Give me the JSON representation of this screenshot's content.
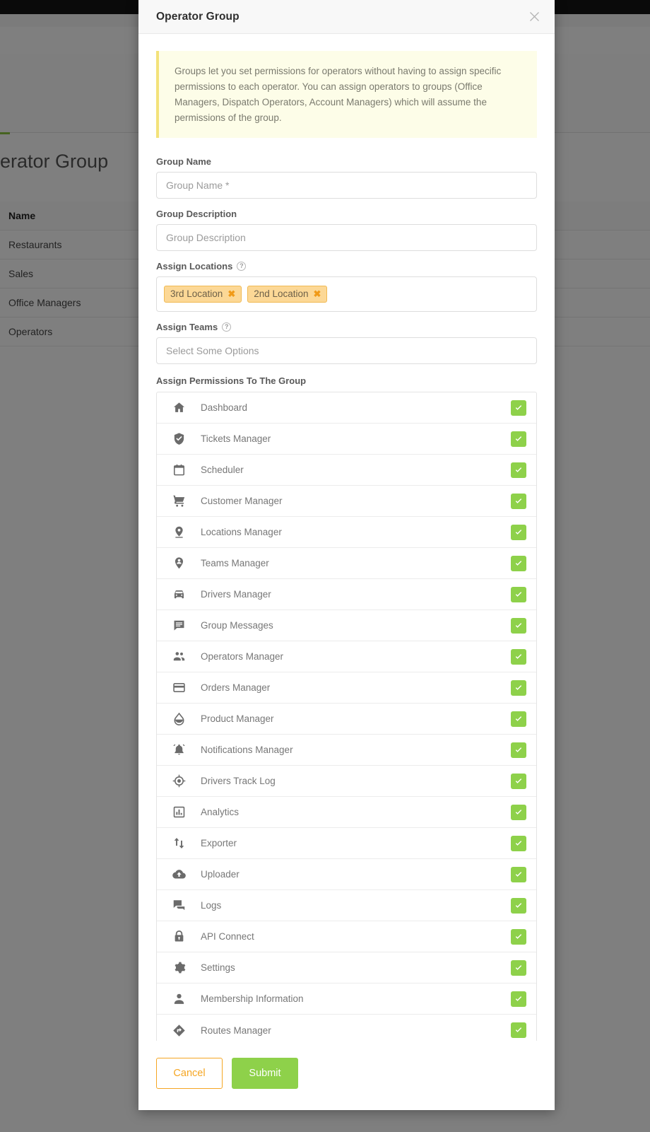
{
  "background": {
    "page_title": "Operator Group",
    "table": {
      "column_header": "Name",
      "rows": [
        "Restaurants",
        "Sales",
        "Office Managers",
        "Operators"
      ]
    }
  },
  "modal": {
    "title": "Operator Group",
    "close_icon": "close-icon",
    "info_text": "Groups let you set permissions for operators without having to assign specific permissions to each operator. You can assign operators to groups (Office Managers, Dispatch Operators, Account Managers) which will assume the permissions of the group.",
    "fields": {
      "group_name": {
        "label": "Group Name",
        "placeholder": "Group Name *",
        "value": ""
      },
      "group_description": {
        "label": "Group Description",
        "placeholder": "Group Description",
        "value": ""
      },
      "assign_locations": {
        "label": "Assign Locations",
        "help_icon": "help-circle-icon",
        "tags": [
          "3rd Location",
          "2nd Location"
        ],
        "tag_remove_glyph": "✖"
      },
      "assign_teams": {
        "label": "Assign Teams",
        "help_icon": "help-circle-icon",
        "placeholder": "Select Some Options",
        "value": ""
      }
    },
    "permissions": {
      "label": "Assign Permissions To The Group",
      "items": [
        {
          "label": "Dashboard",
          "icon": "home-icon",
          "checked": true
        },
        {
          "label": "Tickets Manager",
          "icon": "shield-check-icon",
          "checked": true
        },
        {
          "label": "Scheduler",
          "icon": "calendar-icon",
          "checked": true
        },
        {
          "label": "Customer Manager",
          "icon": "shopping-cart-icon",
          "checked": true
        },
        {
          "label": "Locations Manager",
          "icon": "map-pin-icon",
          "checked": true
        },
        {
          "label": "Teams Manager",
          "icon": "person-pin-icon",
          "checked": true
        },
        {
          "label": "Drivers Manager",
          "icon": "car-icon",
          "checked": true
        },
        {
          "label": "Group Messages",
          "icon": "chat-lines-icon",
          "checked": true
        },
        {
          "label": "Operators Manager",
          "icon": "people-icon",
          "checked": true
        },
        {
          "label": "Orders Manager",
          "icon": "credit-card-icon",
          "checked": true
        },
        {
          "label": "Product Manager",
          "icon": "water-drop-icon",
          "checked": true
        },
        {
          "label": "Notifications Manager",
          "icon": "bell-ring-icon",
          "checked": true
        },
        {
          "label": "Drivers Track Log",
          "icon": "gps-target-icon",
          "checked": true
        },
        {
          "label": "Analytics",
          "icon": "bar-chart-icon",
          "checked": true
        },
        {
          "label": "Exporter",
          "icon": "import-export-icon",
          "checked": true
        },
        {
          "label": "Uploader",
          "icon": "cloud-upload-icon",
          "checked": true
        },
        {
          "label": "Logs",
          "icon": "forum-icon",
          "checked": true
        },
        {
          "label": "API Connect",
          "icon": "lock-icon",
          "checked": true
        },
        {
          "label": "Settings",
          "icon": "gear-icon",
          "checked": true
        },
        {
          "label": "Membership Information",
          "icon": "person-icon",
          "checked": true
        },
        {
          "label": "Routes Manager",
          "icon": "routes-diamond-icon",
          "checked": true
        }
      ]
    },
    "footer": {
      "cancel_label": "Cancel",
      "submit_label": "Submit"
    }
  },
  "colors": {
    "accent_green": "#8ed14a",
    "accent_orange": "#f5a623",
    "tag_bg": "#fcd896",
    "tag_border": "#f0b952",
    "info_bg": "#fdfde8",
    "info_border": "#f3e27a"
  }
}
